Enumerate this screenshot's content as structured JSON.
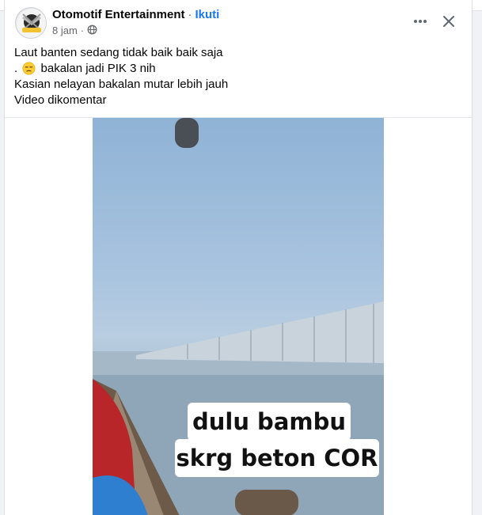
{
  "post": {
    "author": "Otomotif Entertainment",
    "separator": "·",
    "follow_label": "Ikuti",
    "time": "8 jam",
    "meta_separator": "·",
    "privacy_icon": "globe-icon",
    "lines": [
      "Laut banten sedang tidak baik baik saja",
      "bakalan jadi PIK 3 nih",
      "Kasian nelayan bakalan mutar lebih jauh",
      "Video dikomentar"
    ],
    "line2_prefix": ".",
    "emoji": "unamused-face-emoji"
  },
  "video": {
    "caption_line1": "dulu bambu",
    "caption_line2": "skrg beton COR"
  },
  "colors": {
    "accent": "#1877f2",
    "text": "#050505",
    "secondary": "#65676b"
  }
}
